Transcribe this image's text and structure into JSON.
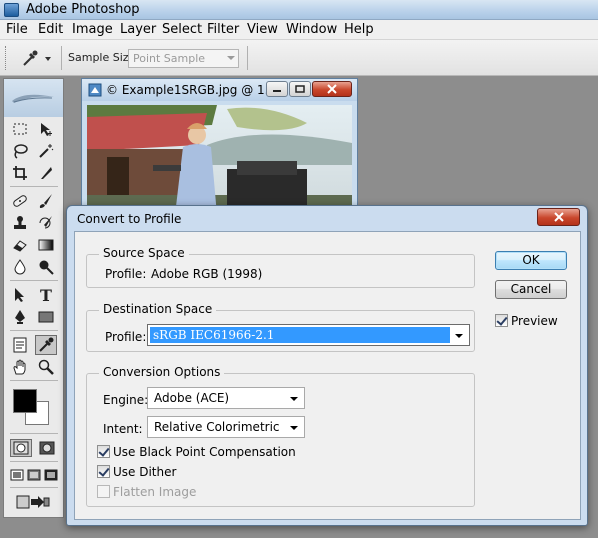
{
  "app": {
    "title": "Adobe Photoshop"
  },
  "menubar": {
    "items": [
      "File",
      "Edit",
      "Image",
      "Layer",
      "Select",
      "Filter",
      "View",
      "Window",
      "Help"
    ]
  },
  "options_bar": {
    "tool_icon": "eyedropper-icon",
    "sample_size_label": "Sample Size:",
    "sample_size_value": "Point Sample"
  },
  "toolbox": {
    "tools": [
      "rectangular-marquee",
      "move",
      "lasso",
      "magic-wand",
      "crop",
      "slice",
      "healing-brush",
      "brush",
      "clone-stamp",
      "history-brush",
      "eraser",
      "gradient",
      "blur",
      "dodge",
      "path-selection",
      "type",
      "pen",
      "rectangle-shape",
      "notes",
      "eyedropper",
      "hand",
      "zoom"
    ],
    "foreground_color": "#000000",
    "background_color": "#ffffff"
  },
  "document": {
    "title": "© Example1SRGB.jpg @ 1..."
  },
  "dialog": {
    "title": "Convert to Profile",
    "source": {
      "legend": "Source Space",
      "profile_label": "Profile:",
      "profile_value": "Adobe RGB (1998)"
    },
    "destination": {
      "legend": "Destination Space",
      "profile_label": "Profile:",
      "profile_value": "sRGB IEC61966-2.1"
    },
    "conversion": {
      "legend": "Conversion Options",
      "engine_label": "Engine:",
      "engine_value": "Adobe (ACE)",
      "intent_label": "Intent:",
      "intent_value": "Relative Colorimetric",
      "black_point": {
        "label": "Use Black Point Compensation",
        "checked": true
      },
      "dither": {
        "label": "Use Dither",
        "checked": true
      },
      "flatten": {
        "label": "Flatten Image",
        "checked": false,
        "disabled": true
      }
    },
    "buttons": {
      "ok": "OK",
      "cancel": "Cancel"
    },
    "preview": {
      "label": "Preview",
      "checked": true
    }
  },
  "colors": {
    "selection": "#3399ff",
    "close_button": "#c9472c",
    "title_bar": "#b9d1ea"
  }
}
